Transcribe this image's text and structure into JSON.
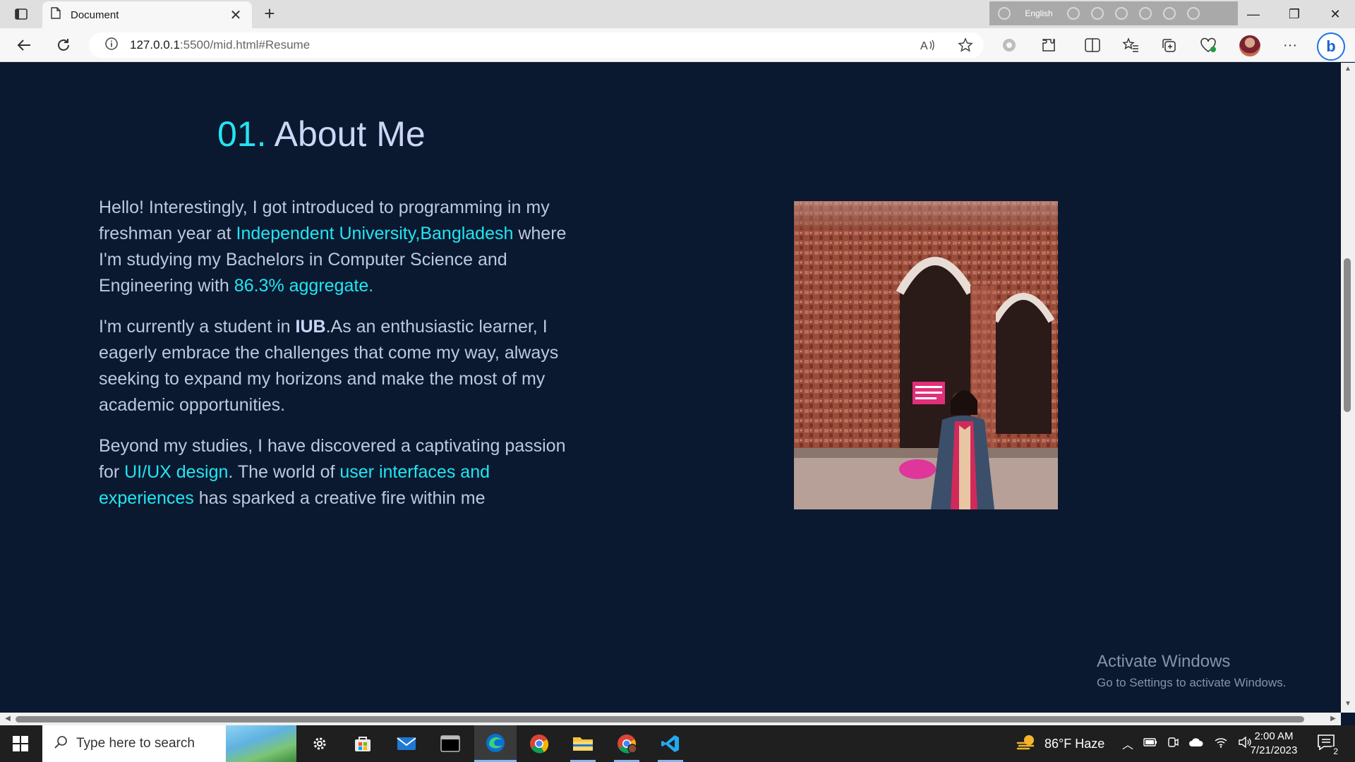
{
  "browser": {
    "tab_title": "Document",
    "url_host": "127.0.0.1",
    "url_rest": ":5500/mid.html#Resume",
    "ime_language": "English"
  },
  "page": {
    "heading_number": "01.",
    "heading_text": "About Me",
    "para1": {
      "t1": "Hello! Interestingly, I got introduced to programming in my freshman year at ",
      "link1": "Independent University,Bangladesh",
      "t2": " where I'm studying my Bachelors in Computer Science and Engineering with ",
      "link2": "86.3% aggregate."
    },
    "para2": {
      "t1": "I'm currently a student in ",
      "bold": "IUB",
      "t2": ".As an enthusiastic learner, I eagerly embrace the challenges that come my way, always seeking to expand my horizons and make the most of my academic opportunities."
    },
    "para3": {
      "t1": "Beyond my studies, I have discovered a captivating passion for ",
      "link1": "UI/UX design",
      "t2": ". The world of ",
      "link2": "user interfaces and experiences",
      "t3": " has sparked a creative fire within me"
    },
    "photo_icon": "profile-photo",
    "accent_color": "#22e5f3",
    "background_color": "#0a192f"
  },
  "watermark": {
    "title": "Activate Windows",
    "subtitle": "Go to Settings to activate Windows."
  },
  "taskbar": {
    "search_placeholder": "Type here to search",
    "weather": "86°F  Haze",
    "time": "2:00 AM",
    "date": "7/21/2023",
    "notification_count": "2"
  }
}
